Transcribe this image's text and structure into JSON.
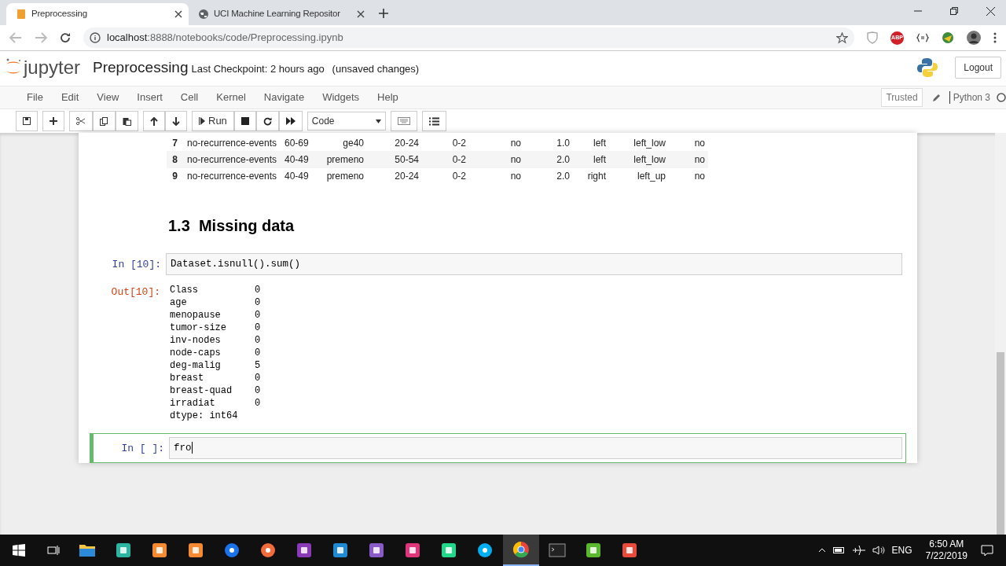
{
  "browser": {
    "tabs": [
      {
        "title": "Preprocessing",
        "kind": "notebook",
        "selected": true
      },
      {
        "title": "UCI Machine Learning Repositor",
        "kind": "globe",
        "selected": false
      }
    ],
    "url_host": "localhost",
    "url_rest": ":8888/notebooks/code/Preprocessing.ipynb",
    "abp": "ABP"
  },
  "header": {
    "logo": "jupyter",
    "title": "Preprocessing",
    "checkpoint": "Last Checkpoint: 2 hours ago",
    "status": "(unsaved changes)",
    "logout": "Logout"
  },
  "menu": [
    "File",
    "Edit",
    "View",
    "Insert",
    "Cell",
    "Kernel",
    "Navigate",
    "Widgets",
    "Help"
  ],
  "kernel": {
    "trusted": "Trusted",
    "name": "Python 3"
  },
  "toolbar": {
    "run": "Run",
    "cell_type": "Code"
  },
  "table_rows": [
    {
      "index": "7",
      "cells": [
        "no-recurrence-events",
        "60-69",
        "ge40",
        "20-24",
        "0-2",
        "no",
        "1.0",
        "left",
        "left_low",
        "no"
      ]
    },
    {
      "index": "8",
      "cells": [
        "no-recurrence-events",
        "40-49",
        "premeno",
        "50-54",
        "0-2",
        "no",
        "2.0",
        "left",
        "left_low",
        "no"
      ]
    },
    {
      "index": "9",
      "cells": [
        "no-recurrence-events",
        "40-49",
        "premeno",
        "20-24",
        "0-2",
        "no",
        "2.0",
        "right",
        "left_up",
        "no"
      ]
    }
  ],
  "heading": {
    "number": "1.3",
    "text": "Missing data"
  },
  "cells": [
    {
      "kind": "code",
      "prompt": "In [10]:",
      "code": "Dataset.isnull().sum()",
      "selected": false
    },
    {
      "kind": "output",
      "prompt": "Out[10]:",
      "lines": [
        [
          "Class",
          "0"
        ],
        [
          "age",
          "0"
        ],
        [
          "menopause",
          "0"
        ],
        [
          "tumor-size",
          "0"
        ],
        [
          "inv-nodes",
          "0"
        ],
        [
          "node-caps",
          "0"
        ],
        [
          "deg-malig",
          "5"
        ],
        [
          "breast",
          "0"
        ],
        [
          "breast-quad",
          "0"
        ],
        [
          "irradiat",
          "0"
        ]
      ],
      "footer": "dtype: int64"
    },
    {
      "kind": "code",
      "prompt": "In [ ]:",
      "code": "fro",
      "selected": true
    }
  ],
  "taskbar": {
    "apps": [
      {
        "kind": "folder",
        "selected": false
      },
      {
        "kind": "diamond",
        "selected": false
      },
      {
        "kind": "orange",
        "selected": false
      },
      {
        "kind": "orange",
        "selected": false
      },
      {
        "kind": "pin",
        "selected": false
      },
      {
        "kind": "rocket",
        "selected": false
      },
      {
        "kind": "purple",
        "selected": false
      },
      {
        "kind": "vscode",
        "selected": false
      },
      {
        "kind": "vs",
        "selected": false
      },
      {
        "kind": "dark",
        "selected": false
      },
      {
        "kind": "green",
        "selected": false
      },
      {
        "kind": "skype",
        "selected": false
      },
      {
        "kind": "chrome",
        "selected": true
      },
      {
        "kind": "terminal",
        "selected": false
      },
      {
        "kind": "camgreen",
        "selected": false
      },
      {
        "kind": "camred",
        "selected": false
      }
    ],
    "lang": "ENG",
    "time": "6:50 AM",
    "date": "7/22/2019"
  }
}
